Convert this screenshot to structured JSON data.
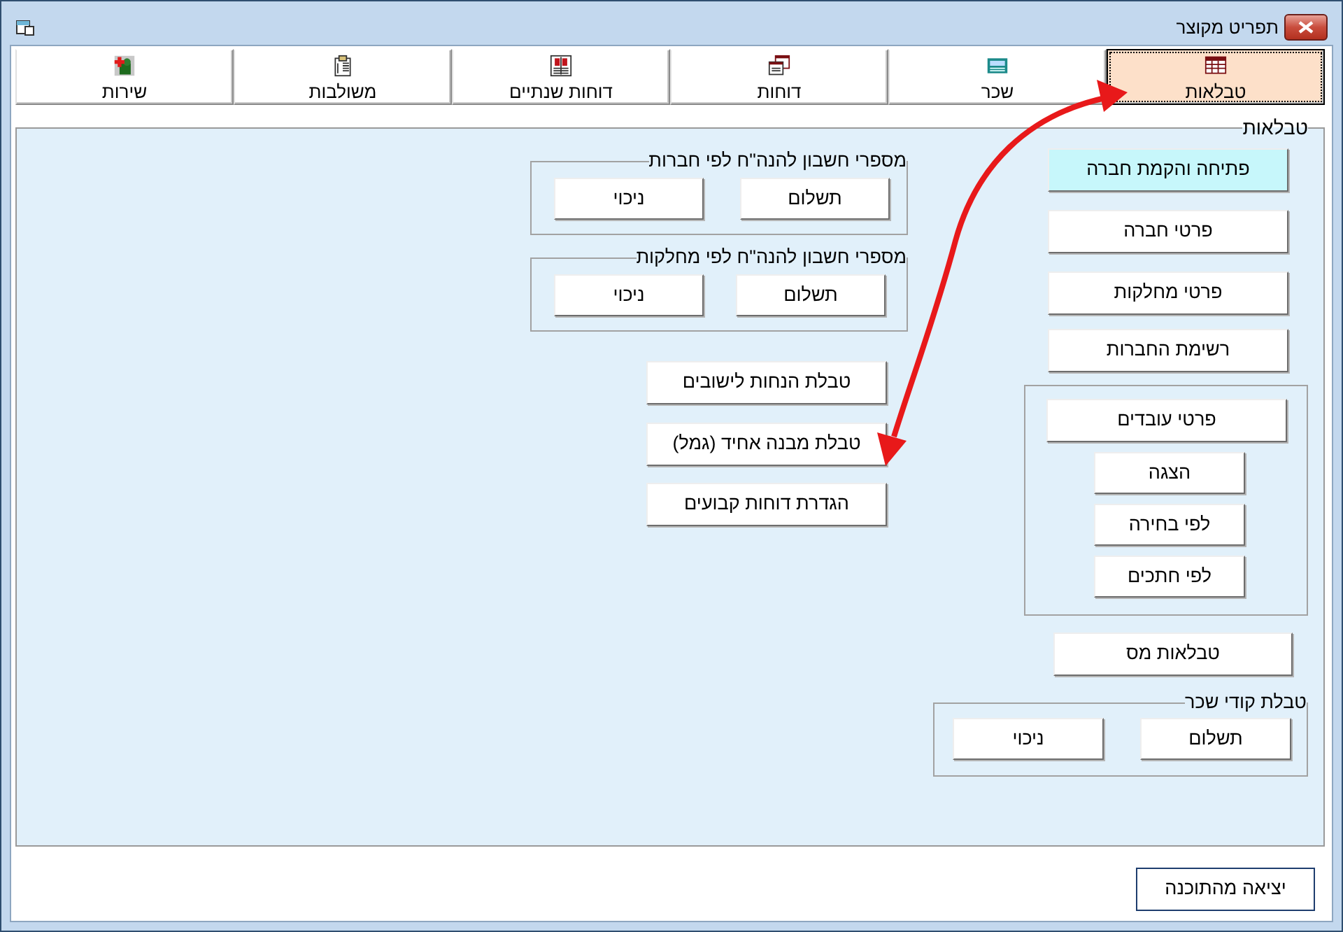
{
  "window": {
    "title": "תפריט מקוצר"
  },
  "tabs": [
    {
      "label": "טבלאות",
      "selected": true
    },
    {
      "label": "שכר",
      "selected": false
    },
    {
      "label": "דוחות",
      "selected": false
    },
    {
      "label": "דוחות שנתיים",
      "selected": false
    },
    {
      "label": "משולבות",
      "selected": false
    },
    {
      "label": "שירות",
      "selected": false
    }
  ],
  "panel": {
    "title": "טבלאות",
    "right_column": [
      {
        "kind": "button",
        "label": "פתיחה והקמת חברה",
        "highlighted": true
      },
      {
        "kind": "button",
        "label": "פרטי חברה",
        "highlighted": false
      },
      {
        "kind": "button",
        "label": "פרטי מחלקות",
        "highlighted": false
      },
      {
        "kind": "button",
        "label": "רשימת החברות",
        "highlighted": false
      },
      {
        "kind": "stack_group",
        "buttons": [
          {
            "label": "פרטי עובדים",
            "highlighted": false
          },
          {
            "label": "הצגה",
            "highlighted": false
          },
          {
            "label": "לפי בחירה",
            "highlighted": false
          },
          {
            "label": "לפי חתכים",
            "highlighted": false
          }
        ]
      },
      {
        "kind": "button",
        "label": "טבלאות מס",
        "highlighted": false
      },
      {
        "kind": "pair_group",
        "title": "טבלת קודי שכר",
        "buttons": [
          {
            "label": "תשלום",
            "highlighted": false
          },
          {
            "label": "ניכוי",
            "highlighted": false
          }
        ]
      }
    ],
    "middle_column": [
      {
        "kind": "pair_group",
        "title": "מספרי חשבון להנה\"ח לפי חברות",
        "buttons": [
          {
            "label": "תשלום",
            "highlighted": false
          },
          {
            "label": "ניכוי",
            "highlighted": false
          }
        ]
      },
      {
        "kind": "pair_group",
        "title": "מספרי חשבון להנה\"ח לפי מחלקות",
        "buttons": [
          {
            "label": "תשלום",
            "highlighted": false
          },
          {
            "label": "ניכוי",
            "highlighted": false
          }
        ]
      },
      {
        "kind": "button",
        "label": "טבלת הנחות לישובים",
        "highlighted": false
      },
      {
        "kind": "button",
        "label": "טבלת מבנה אחיד (גמל)",
        "highlighted": false
      },
      {
        "kind": "button",
        "label": "הגדרת דוחות קבועים",
        "highlighted": false
      }
    ]
  },
  "exit_button": {
    "label": "יציאה מהתוכנה"
  }
}
